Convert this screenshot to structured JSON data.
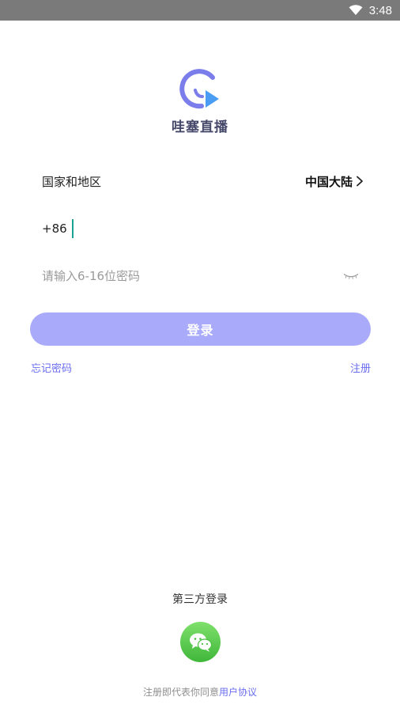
{
  "status_bar": {
    "time": "3:48",
    "icons": [
      "wifi-icon",
      "battery-icon"
    ]
  },
  "app": {
    "name": "哇塞直播",
    "logo_icon": "play-circle-logo-icon",
    "colors": {
      "logo_ring": "#7b7eea",
      "logo_play": "#4b9df3"
    }
  },
  "form": {
    "region_label": "国家和地区",
    "region_value": "中国大陆",
    "phone_prefix": "+86",
    "phone_value": "",
    "password_placeholder": "请输入6-16位密码",
    "password_value": "",
    "eye_icon": "eye-closed-icon"
  },
  "login": {
    "label": "登录",
    "color": "#a9abfa"
  },
  "links": {
    "forgot_password": "忘记密码",
    "register": "注册",
    "color": "#6a6df0"
  },
  "third_party": {
    "title": "第三方登录",
    "wechat_icon": "wechat-icon",
    "color": "#4cc043"
  },
  "agreement": {
    "prefix": "注册即代表你同意",
    "link": "用户协议"
  }
}
